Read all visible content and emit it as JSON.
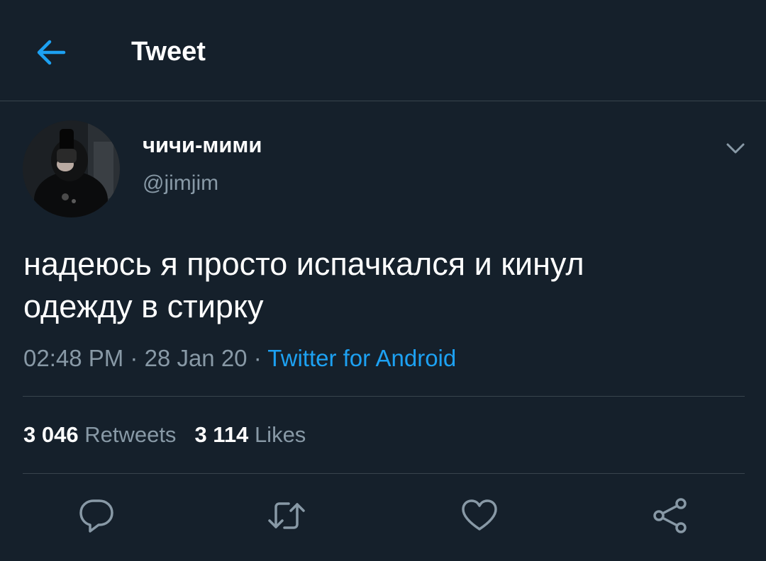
{
  "header": {
    "title": "Tweet",
    "back_icon": "arrow-left-icon"
  },
  "author": {
    "display_name": "чичи-мими",
    "handle": "@jimjim",
    "menu_icon": "chevron-down-icon"
  },
  "tweet": {
    "text_line1": "надеюсь я просто испачкался и кинул",
    "text_line2": "одежду в стирку",
    "time": "02:48 PM",
    "sep1": " · ",
    "date": "28 Jan 20",
    "sep2": " · ",
    "source": "Twitter for Android"
  },
  "stats": {
    "retweets_count": "3 046",
    "retweets_label": "Retweets",
    "likes_count": "3 114",
    "likes_label": "Likes"
  },
  "actions": [
    {
      "icon": "reply-icon"
    },
    {
      "icon": "retweet-icon"
    },
    {
      "icon": "like-icon"
    },
    {
      "icon": "share-icon"
    }
  ],
  "colors": {
    "background": "#15202b",
    "accent": "#1da1f2",
    "secondary_text": "#8899a6",
    "divider": "#38444d"
  }
}
